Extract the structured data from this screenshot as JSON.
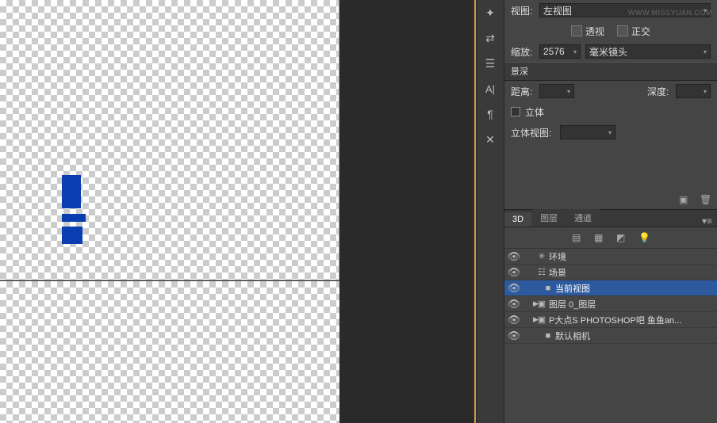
{
  "view": {
    "label": "视图:",
    "value": "左视图",
    "watermark": "WWW.MISSYUAN.COM",
    "perspective": "透视",
    "orthographic": "正交",
    "zoom_label": "缩放:",
    "zoom_value": "2576",
    "lens_value": "毫米镜头"
  },
  "dof": {
    "section": "景深",
    "distance_label": "距离:",
    "distance_value": "",
    "depth_label": "深度:",
    "depth_value": ""
  },
  "stereo": {
    "checkbox_label": "立体",
    "view_label": "立体视图:",
    "view_value": ""
  },
  "tabs": {
    "t3d": "3D",
    "layers": "图层",
    "channels": "通道"
  },
  "layers": [
    {
      "icon": "env",
      "label": "环境",
      "indent": 0,
      "expand": "",
      "selected": false
    },
    {
      "icon": "scene",
      "label": "场景",
      "indent": 0,
      "expand": "",
      "selected": false
    },
    {
      "icon": "cam",
      "label": "当前视图",
      "indent": 2,
      "expand": "",
      "selected": true
    },
    {
      "icon": "mesh",
      "label": "图层 0_图层",
      "indent": 1,
      "expand": "▶",
      "selected": false
    },
    {
      "icon": "mesh",
      "label": "P大点S PHOTOSHOP吧 鱼鱼an...",
      "indent": 1,
      "expand": "▶",
      "selected": false
    },
    {
      "icon": "cam",
      "label": "默认相机",
      "indent": 2,
      "expand": "",
      "selected": false
    }
  ]
}
